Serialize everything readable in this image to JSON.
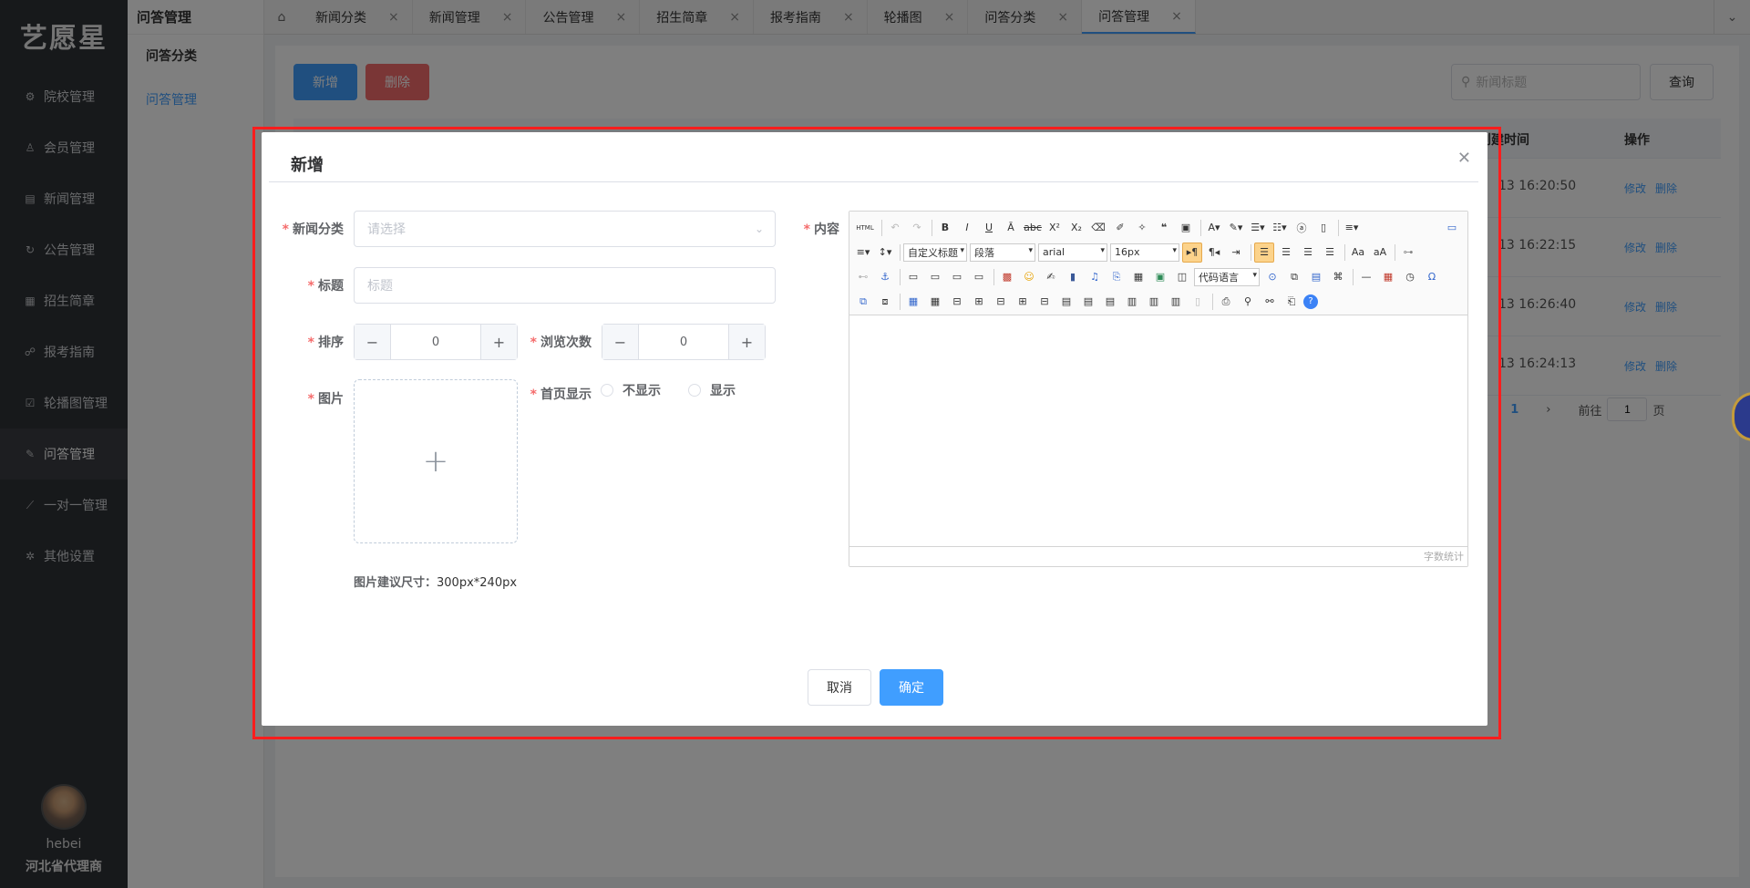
{
  "logo": "艺愿星",
  "sidebar": {
    "items": [
      {
        "label": "院校管理",
        "icon": "gear-icon"
      },
      {
        "label": "会员管理",
        "icon": "gift-icon"
      },
      {
        "label": "新闻管理",
        "icon": "news-icon"
      },
      {
        "label": "公告管理",
        "icon": "refresh-icon"
      },
      {
        "label": "招生简章",
        "icon": "document-icon"
      },
      {
        "label": "报考指南",
        "icon": "guide-icon"
      },
      {
        "label": "轮播图管理",
        "icon": "checkbox-icon"
      },
      {
        "label": "问答管理",
        "icon": "edit-icon"
      },
      {
        "label": "一对一管理",
        "icon": "link-icon"
      },
      {
        "label": "其他设置",
        "icon": "settings-icon"
      }
    ],
    "user": {
      "name": "hebei",
      "role": "河北省代理商"
    }
  },
  "submenu": {
    "title": "问答管理",
    "items": [
      "问答分类",
      "问答管理"
    ]
  },
  "tabs": [
    "新闻分类",
    "新闻管理",
    "公告管理",
    "招生简章",
    "报考指南",
    "轮播图",
    "问答分类",
    "问答管理"
  ],
  "background": {
    "new_label": "新增",
    "delete_label": "删除",
    "search_placeholder": "新闻标题",
    "query_label": "查询",
    "columns": {
      "time": "创建时间",
      "ops": "操作"
    },
    "times": [
      "13 16:20:50",
      "13 16:22:15",
      "13 16:26:40",
      "13 16:24:13"
    ],
    "edit_label": "修改",
    "remove_label": "删除",
    "pager": {
      "page": "1",
      "goto": "前往",
      "input": "1",
      "unit": "页"
    }
  },
  "dialog": {
    "title": "新增",
    "category_label": "新闻分类",
    "category_placeholder": "请选择",
    "title_label": "标题",
    "title_placeholder": "标题",
    "sort_label": "排序",
    "sort_value": "0",
    "views_label": "浏览次数",
    "views_value": "0",
    "image_label": "图片",
    "homepage_label": "首页显示",
    "radio_hide": "不显示",
    "radio_show": "显示",
    "image_hint_label": "图片建议尺寸：",
    "image_hint_value": "300px*240px",
    "content_label": "内容",
    "editor": {
      "custom_title": "自定义标题",
      "paragraph": "段落",
      "font": "arial",
      "size": "16px",
      "code_lang": "代码语言",
      "word_count": "字数统计"
    },
    "cancel_label": "取消",
    "confirm_label": "确定"
  }
}
